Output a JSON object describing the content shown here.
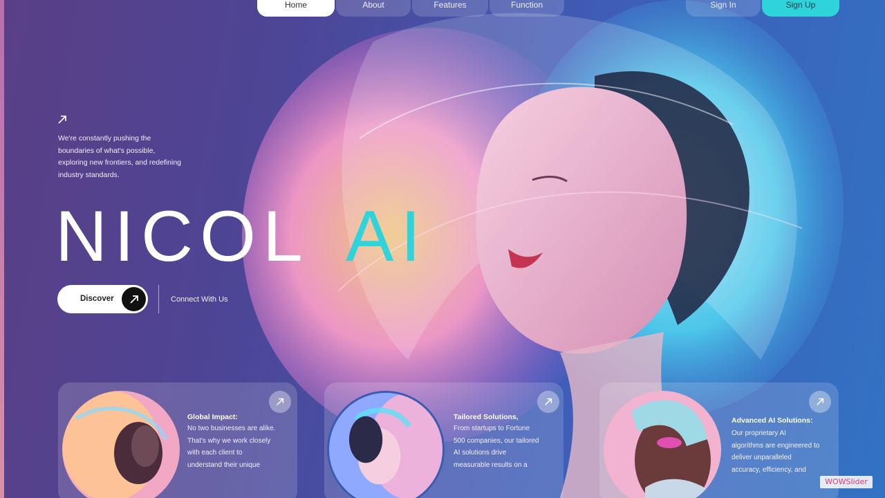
{
  "nav": {
    "left": [
      {
        "label": "Home",
        "active": true
      },
      {
        "label": "About",
        "active": false
      },
      {
        "label": "Features",
        "active": false
      },
      {
        "label": "Function",
        "active": false
      }
    ],
    "sign_in": "Sign In",
    "sign_up": "Sign Up"
  },
  "hero": {
    "intro_icon": "arrow-up-right-icon",
    "intro_lines": [
      "We're constantly pushing the",
      "boundaries of what's possible,",
      "exploring new frontiers, and redefining",
      "industry standards."
    ],
    "brand_main": "NICOL",
    "brand_accent": "AI",
    "discover_label": "Discover",
    "connect_label": "Connect With Us"
  },
  "cards": [
    {
      "title": "Global Impact:",
      "lines": [
        "No two businesses are alike.",
        "That's why we work closely",
        "with each client to",
        "understand their unique"
      ]
    },
    {
      "title": "Tailored Solutions,",
      "lines": [
        "From startups to Fortune",
        "500 companies, our tailored",
        "AI solutions drive",
        "measurable results on a"
      ]
    },
    {
      "title": "Advanced AI Solutions:",
      "lines": [
        "Our proprietary AI",
        "algorithms are engineered to",
        "deliver unparalleled",
        "accuracy, efficiency, and"
      ]
    }
  ],
  "watermark": "WOWSlider",
  "colors": {
    "accent": "#2fd3da",
    "background_left": "#5a3f86",
    "background_right": "#3272c4"
  }
}
